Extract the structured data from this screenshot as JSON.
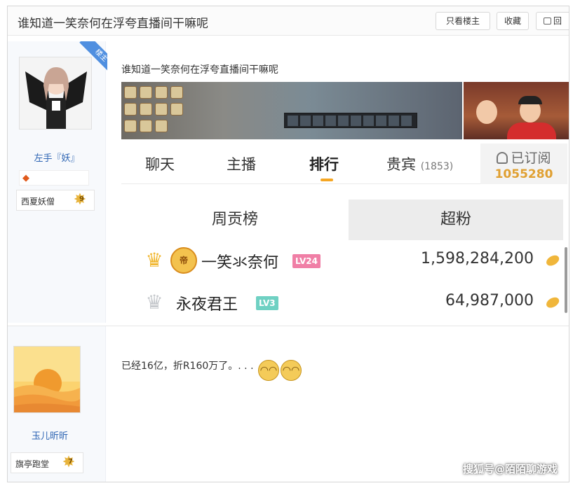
{
  "thread": {
    "title": "谁知道一笑奈何在浮夸直播间干嘛呢",
    "buttons": {
      "only_op": "只看楼主",
      "favorite": "收藏",
      "reply": "回"
    }
  },
  "posts": [
    {
      "badge": "楼主",
      "user": {
        "name": "左手『妖』",
        "level_title": "西夏妖僧",
        "level": "9"
      },
      "text": "谁知道一笑奈何在浮夸直播间干嘛呢",
      "stream_panel": {
        "tabs": [
          {
            "label": "聊天"
          },
          {
            "label": "主播"
          },
          {
            "label": "排行"
          },
          {
            "label": "贵宾",
            "count": "(1853)"
          }
        ],
        "subscribe": {
          "label": "已订阅",
          "count": "1055280"
        },
        "rank_tabs": {
          "week": "周贡榜",
          "super": "超粉"
        },
        "ranking": [
          {
            "rank": "1",
            "name": "一笑氺奈何",
            "level": "LV24",
            "amount": "1,598,284,200"
          },
          {
            "rank": "2",
            "name": "永夜君王",
            "level": "LV3",
            "amount": "64,987,000"
          }
        ]
      }
    },
    {
      "user": {
        "name": "玉儿昕昕",
        "level_title": "旗亭跑堂",
        "level": "7"
      },
      "text": "已经16亿，折R160万了。. . ."
    }
  ],
  "watermark": "搜狐号@陌陌聊游戏",
  "colors": {
    "link_blue": "#2d64b3",
    "accent_gold": "#e0a032",
    "badge_blue": "#4f8fe0",
    "lv_pink": "#f07fa6",
    "lv_teal": "#6fd1c3"
  }
}
